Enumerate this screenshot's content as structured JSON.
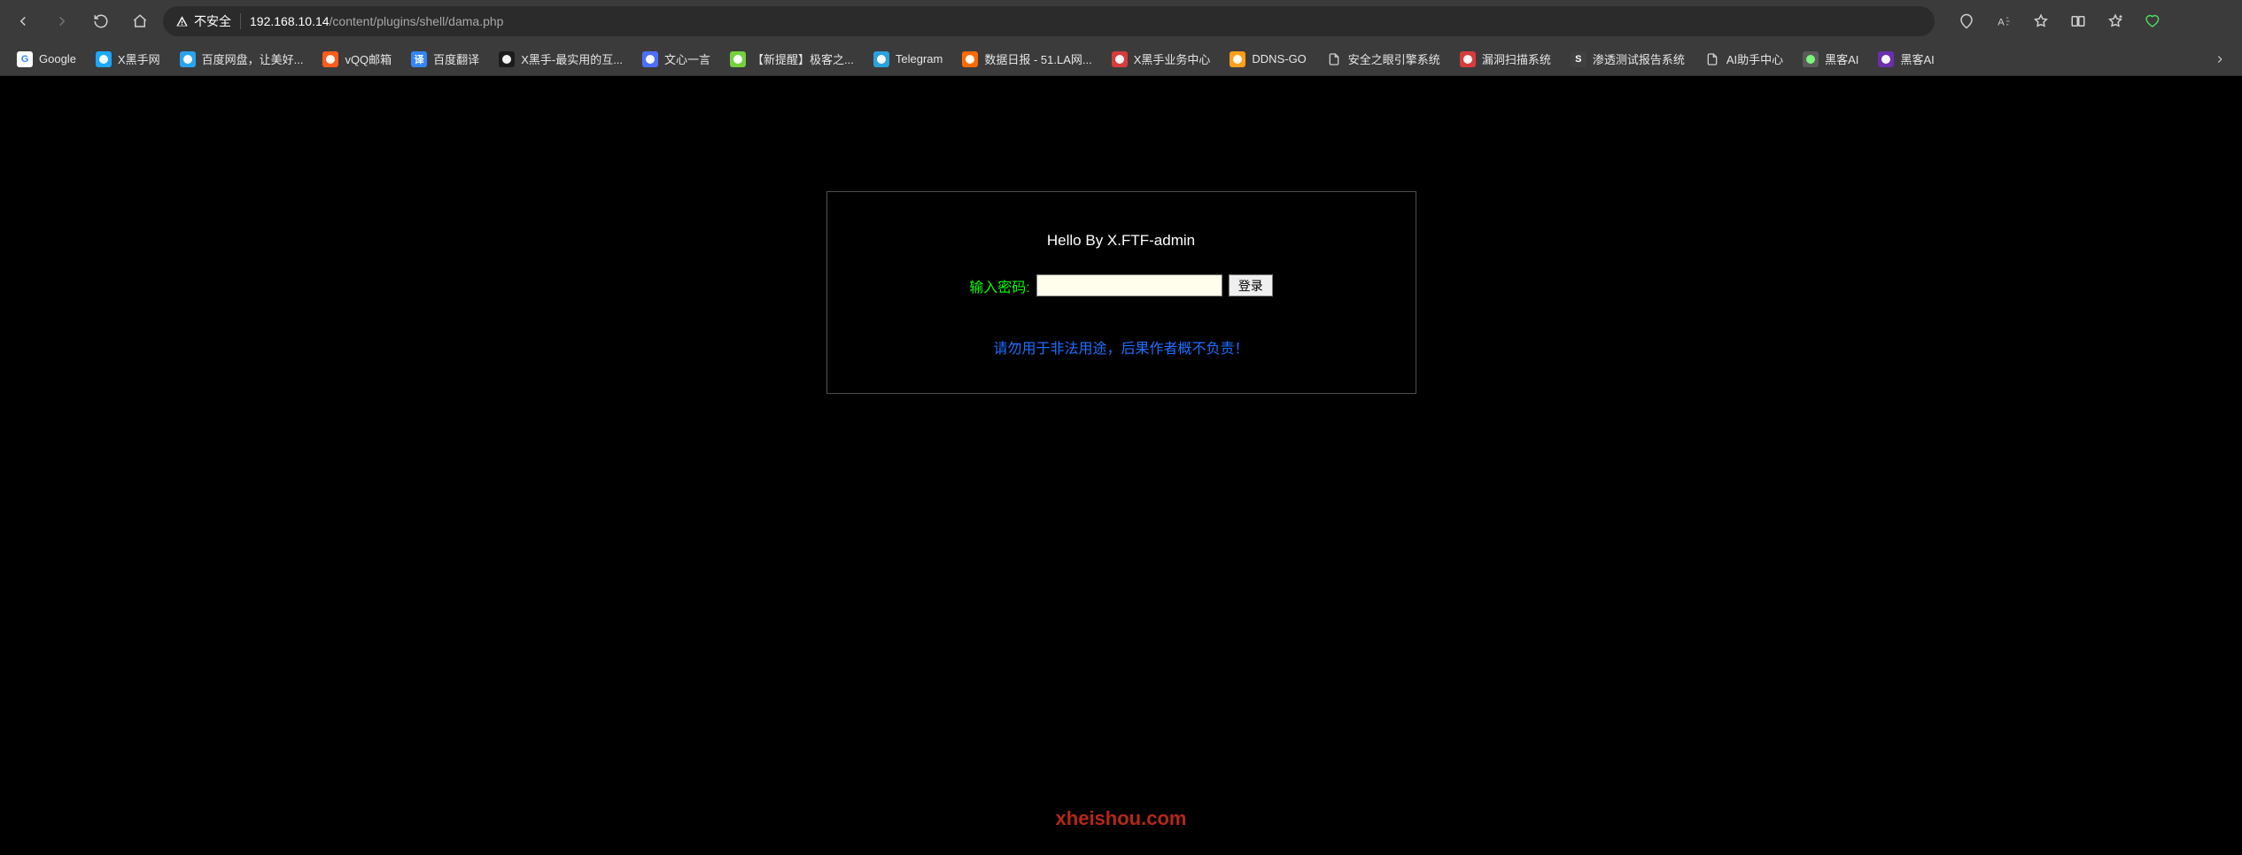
{
  "toolbar": {
    "insecure_label": "不安全",
    "url_host": "192.168.10.14",
    "url_path": "/content/plugins/shell/dama.php"
  },
  "bookmarks": [
    {
      "label": "Google",
      "icon_letter": "G",
      "icon_bg": "#ffffff",
      "icon_fg": "#4285f4"
    },
    {
      "label": "X黑手网",
      "icon_letter": "",
      "icon_bg": "#1aa8ff",
      "icon_fg": "#fff"
    },
    {
      "label": "百度网盘，让美好...",
      "icon_letter": "",
      "icon_bg": "#2aa3ef",
      "icon_fg": "#fff"
    },
    {
      "label": "vQQ邮箱",
      "icon_letter": "",
      "icon_bg": "#ff5c1a",
      "icon_fg": "#fff"
    },
    {
      "label": "百度翻译",
      "icon_letter": "译",
      "icon_bg": "#3385ff",
      "icon_fg": "#fff"
    },
    {
      "label": "X黑手-最实用的互...",
      "icon_letter": "",
      "icon_bg": "#1c1c1c",
      "icon_fg": "#fff"
    },
    {
      "label": "文心一言",
      "icon_letter": "",
      "icon_bg": "#4c6fff",
      "icon_fg": "#fff"
    },
    {
      "label": "【新提醒】极客之...",
      "icon_letter": "",
      "icon_bg": "#74d13d",
      "icon_fg": "#fff"
    },
    {
      "label": "Telegram",
      "icon_letter": "",
      "icon_bg": "#2aa1da",
      "icon_fg": "#fff"
    },
    {
      "label": "数据日报 - 51.LA网...",
      "icon_letter": "",
      "icon_bg": "#ff6a00",
      "icon_fg": "#fff"
    },
    {
      "label": "X黑手业务中心",
      "icon_letter": "",
      "icon_bg": "#d83b3b",
      "icon_fg": "#fff"
    },
    {
      "label": "DDNS-GO",
      "icon_letter": "",
      "icon_bg": "#ff9f1a",
      "icon_fg": "#fff"
    },
    {
      "label": "安全之眼引擎系统",
      "icon_letter": "",
      "icon_bg": "transparent",
      "icon_fg": "#ccc",
      "is_page": true
    },
    {
      "label": "漏洞扫描系统",
      "icon_letter": "",
      "icon_bg": "#d83b3b",
      "icon_fg": "#fff"
    },
    {
      "label": "渗透测试报告系统",
      "icon_letter": "S",
      "icon_bg": "#404040",
      "icon_fg": "#fff"
    },
    {
      "label": "AI助手中心",
      "icon_letter": "",
      "icon_bg": "transparent",
      "icon_fg": "#ccc",
      "is_page": true
    },
    {
      "label": "黑客AI",
      "icon_letter": "",
      "icon_bg": "#5a5a5a",
      "icon_fg": "#7cff7c"
    },
    {
      "label": "黑客AI",
      "icon_letter": "",
      "icon_bg": "#6a2fae",
      "icon_fg": "#fff"
    }
  ],
  "page": {
    "title": "Hello By X.FTF-admin",
    "password_label": "输入密码:",
    "login_button": "登录",
    "warning": "请勿用于非法用途，后果作者概不负责！",
    "watermark": "xheishou.com"
  }
}
